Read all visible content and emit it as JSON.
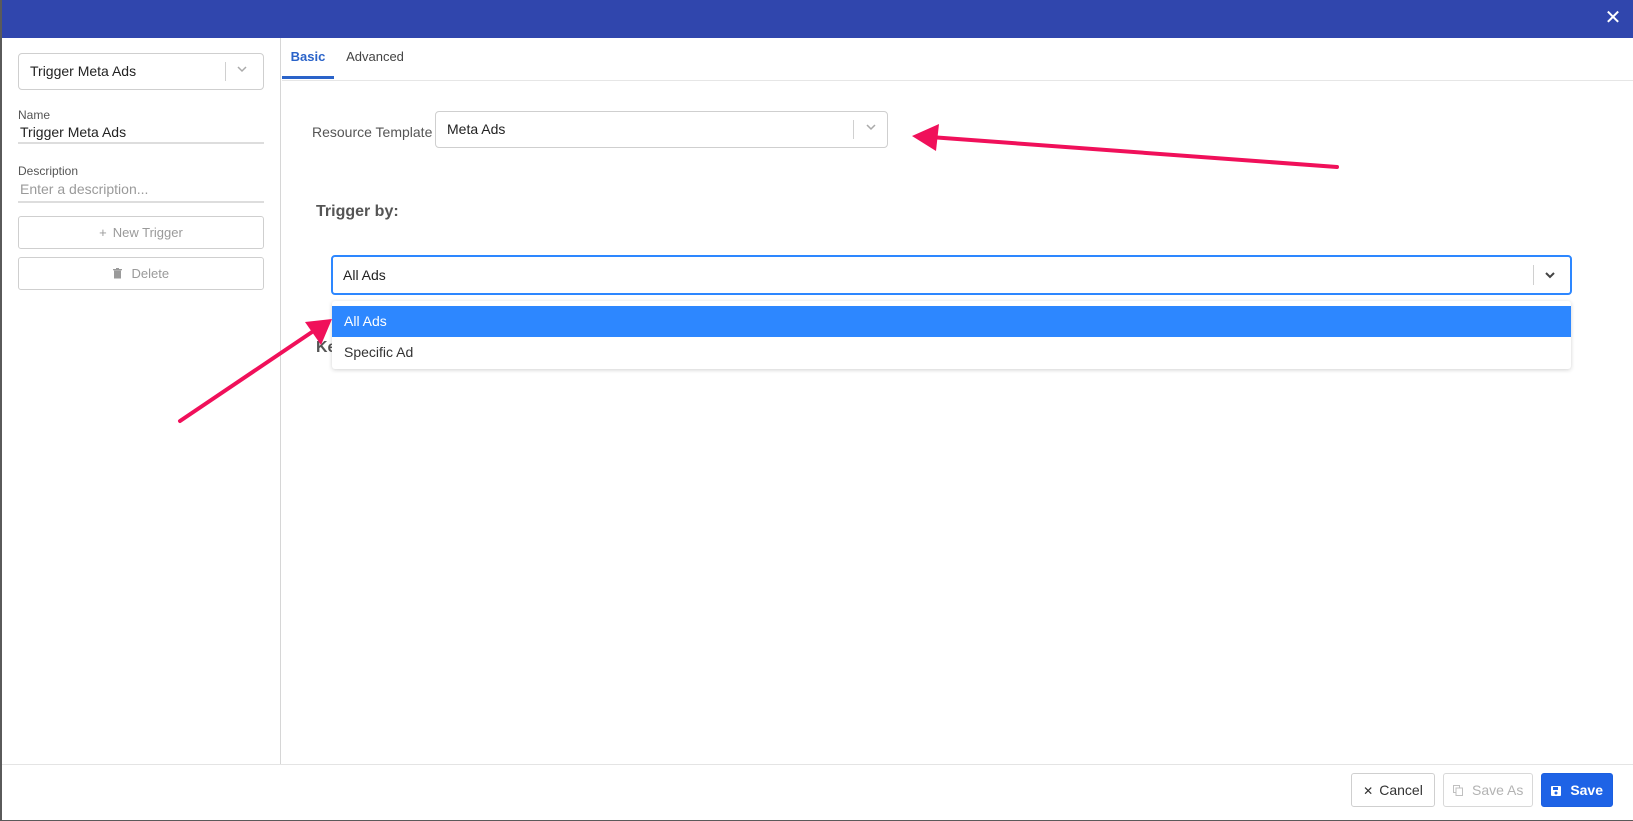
{
  "header": {
    "close_icon": "close-icon"
  },
  "sidebar": {
    "trigger_select": {
      "value": "Trigger Meta Ads"
    },
    "name": {
      "label": "Name",
      "value": "Trigger Meta Ads"
    },
    "description": {
      "label": "Description",
      "placeholder": "Enter a description..."
    },
    "new_trigger": {
      "icon": "+",
      "label": "New Trigger"
    },
    "delete": {
      "icon": "trash-icon",
      "label": "Delete"
    }
  },
  "tabs": [
    {
      "label": "Basic",
      "active": true
    },
    {
      "label": "Advanced",
      "active": false
    }
  ],
  "resource_template": {
    "label": "Resource Template",
    "value": "Meta Ads"
  },
  "trigger_by": {
    "heading": "Trigger by:",
    "value": "All Ads",
    "options": [
      "All Ads",
      "Specific Ad"
    ],
    "selected_index": 0
  },
  "partially_hidden_heading": "Ke",
  "footer": {
    "cancel": "Cancel",
    "save_as": "Save As",
    "save": "Save"
  },
  "colors": {
    "header": "#3046ad",
    "accent": "#1e63e6",
    "selected_option": "#2d87ff",
    "annotation_arrow": "#f0105a"
  }
}
